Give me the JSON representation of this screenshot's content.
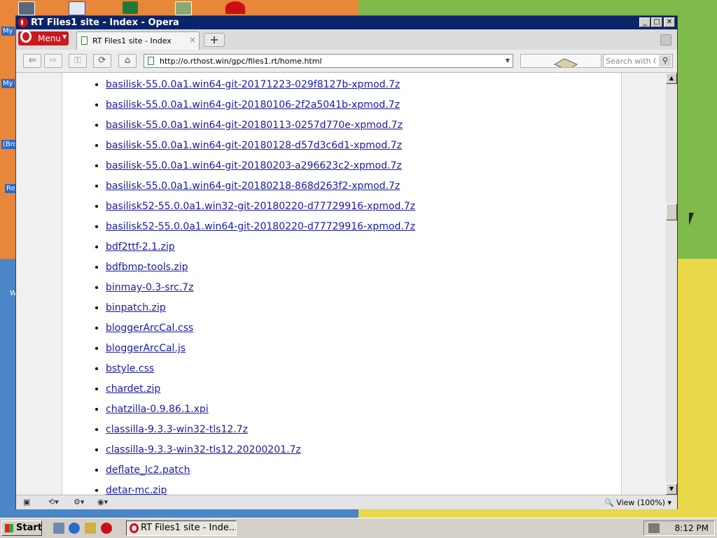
{
  "window": {
    "title": "RT Files1 site - Index - Opera",
    "minimize_glyph": "_",
    "maximize_glyph": "□",
    "close_glyph": "✕"
  },
  "tabbar": {
    "menu_label": "Menu",
    "tab_title": "RT Files1 site - Index",
    "tab_close_glyph": "×",
    "new_tab_glyph": "+"
  },
  "navbar": {
    "back_glyph": "⇦",
    "forward_glyph": "⇨",
    "key_glyph": "⚿",
    "reload_glyph": "⟳",
    "home_glyph": "⌂",
    "url": "http://o.rthost.win/gpc/files1.rt/home.html",
    "search_placeholder": "Search with Co",
    "search_glyph": "⚲"
  },
  "files": [
    "basilisk-55.0.0a1.win64-git-20171223-029f8127b-xpmod.7z",
    "basilisk-55.0.0a1.win64-git-20180106-2f2a5041b-xpmod.7z",
    "basilisk-55.0.0a1.win64-git-20180113-0257d770e-xpmod.7z",
    "basilisk-55.0.0a1.win64-git-20180128-d57d3c6d1-xpmod.7z",
    "basilisk-55.0.0a1.win64-git-20180203-a296623c2-xpmod.7z",
    "basilisk-55.0.0a1.win64-git-20180218-868d263f2-xpmod.7z",
    "basilisk52-55.0.0a1.win32-git-20180220-d77729916-xpmod.7z",
    "basilisk52-55.0.0a1.win64-git-20180220-d77729916-xpmod.7z",
    "bdf2ttf-2.1.zip",
    "bdfbmp-tools.zip",
    "binmay-0.3-src.7z",
    "binpatch.zip",
    "bloggerArcCal.css",
    "bloggerArcCal.js",
    "bstyle.css",
    "chardet.zip",
    "chatzilla-0.9.86.1.xpi",
    "classilla-9.3.3-win32-tls12.7z",
    "classilla-9.3.3-win32-tls12.20200201.7z",
    "deflate_lc2.patch",
    "detar-mc.zip"
  ],
  "statusbar": {
    "zoom_label": "View (100%)"
  },
  "desktop": {
    "labels": [
      "My",
      "My",
      "(Bro",
      "Re",
      "W"
    ]
  },
  "taskbar": {
    "start_label": "Start",
    "task_title": "RT Files1 site - Inde...",
    "clock": "8:12 PM"
  },
  "colors": {
    "titlebar": "#0a246a",
    "opera_red": "#cc0f16",
    "link": "#1a1aa6"
  }
}
